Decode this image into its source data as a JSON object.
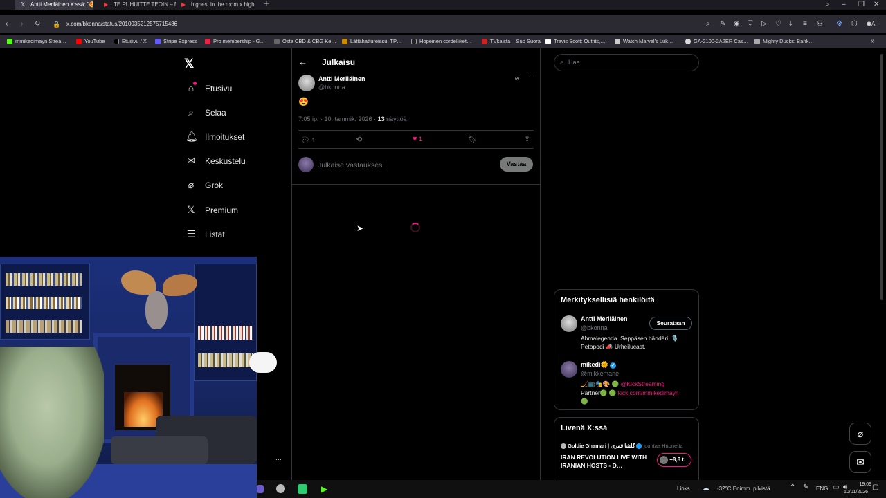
{
  "browser": {
    "tabs": [
      {
        "title": "Antti Meriläinen X:ssä: \"😍\"",
        "active": true
      },
      {
        "title": "TE PUHUITTE TEOIN – MIE…",
        "active": false
      },
      {
        "title": "highest in the room x high…",
        "active": false
      }
    ],
    "url": "x.com/bkonna/status/2010035212575715486",
    "bookmarks": [
      "mmikedimayn Strea…",
      "YouTube",
      "Etusivu / X",
      "Stripe Express",
      "Pro membership - G…",
      "Osta CBD & CBG Ke…",
      "Lättähattureissu: TP…",
      "Hopeinen cordelliket…",
      "TVkaista – Sub Suora",
      "Travis Scott: Outfits,…",
      "Watch Marvel's Luk…",
      "GA-2100-2A2ER Cas…",
      "Mighty Ducks: Bank…"
    ]
  },
  "nav": {
    "items": [
      {
        "label": "Etusivu",
        "icon": "home-icon"
      },
      {
        "label": "Selaa",
        "icon": "search-icon"
      },
      {
        "label": "Ilmoitukset",
        "icon": "bell-icon"
      },
      {
        "label": "Keskustelu",
        "icon": "envelope-icon"
      },
      {
        "label": "Grok",
        "icon": "grok-icon"
      },
      {
        "label": "Premium",
        "icon": "x-icon"
      },
      {
        "label": "Listat",
        "icon": "list-icon"
      }
    ]
  },
  "post": {
    "header_title": "Julkaisu",
    "author_name": "Antti Meriläinen",
    "author_handle": "@bkonna",
    "content": "😍",
    "time": "7.05 ip. · 10. tammik. 2026 ·",
    "views_count": "13",
    "views_label": "näyttöä",
    "reply_count": "1",
    "like_count": "1",
    "reply_placeholder": "Julkaise vastauksesi",
    "reply_button": "Vastaa"
  },
  "search": {
    "placeholder": "Hae"
  },
  "relevant": {
    "title": "Merkityksellisiä henkilöitä",
    "people": [
      {
        "name": "Antti Meriläinen",
        "handle": "@bkonna",
        "bio": "Ahmalegenda. Seppäsen bändäri. 🎙️ Petopodi 📣 Urheilucast.",
        "button": "Seurataan"
      },
      {
        "name": "mikedi🌞",
        "handle": "@mikkemane",
        "bio_prefix": "🏒📺🎭🎨 🟢",
        "bio_link1": "@KickStreaming",
        "bio_mid": "Partner🟢 🟢",
        "bio_link2": "kick.com/mmikedimayn",
        "bio_end": "🟢"
      }
    ]
  },
  "live": {
    "title": "Livenä X:ssä",
    "host_name": "Goldie Ghamari | گلشا قمری",
    "host_action": "juontaa Huonetta",
    "room_title": "IRAN REVOLUTION LIVE WITH IRANIAN HOSTS - D…",
    "listeners": "+8,8 t."
  },
  "taskbar": {
    "links": "Links",
    "weather": "-32°C  Enimm. pilvistä",
    "lang": "ENG",
    "time": "19.09",
    "date": "10/01/2026"
  },
  "colors": {
    "accent_pink": "#f91880",
    "bg": "#000000",
    "border": "#2f3336",
    "text_secondary": "#71767b"
  }
}
